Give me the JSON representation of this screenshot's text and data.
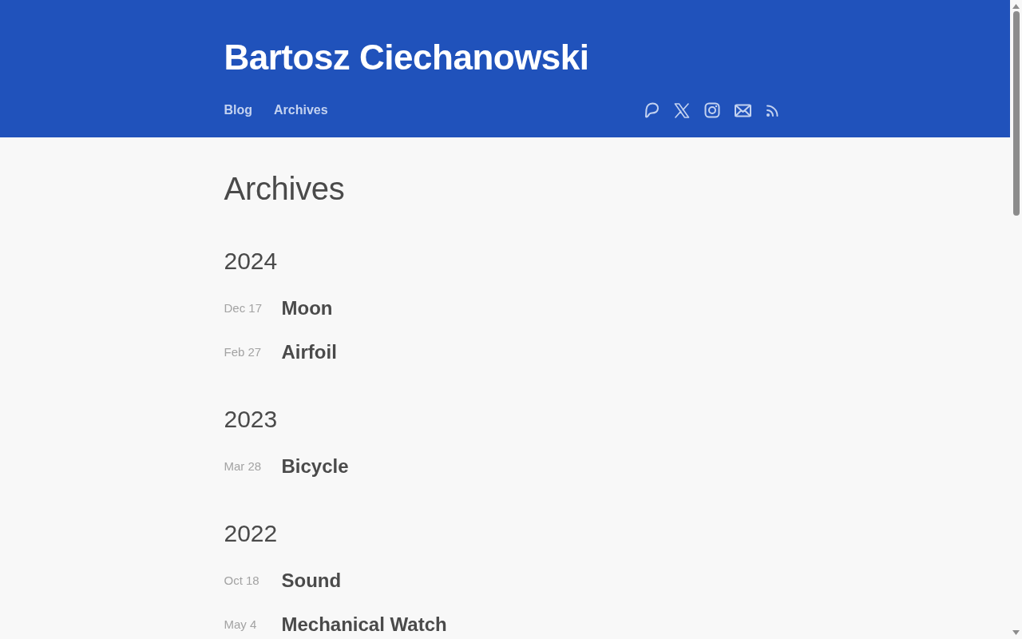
{
  "header": {
    "title": "Bartosz Ciechanowski",
    "nav": [
      "Blog",
      "Archives"
    ]
  },
  "page_title": "Archives",
  "years": [
    {
      "year": "2024",
      "posts": [
        {
          "date": "Dec 17",
          "title": "Moon"
        },
        {
          "date": "Feb 27",
          "title": "Airfoil"
        }
      ]
    },
    {
      "year": "2023",
      "posts": [
        {
          "date": "Mar 28",
          "title": "Bicycle"
        }
      ]
    },
    {
      "year": "2022",
      "posts": [
        {
          "date": "Oct 18",
          "title": "Sound"
        },
        {
          "date": "May 4",
          "title": "Mechanical Watch"
        }
      ]
    }
  ]
}
